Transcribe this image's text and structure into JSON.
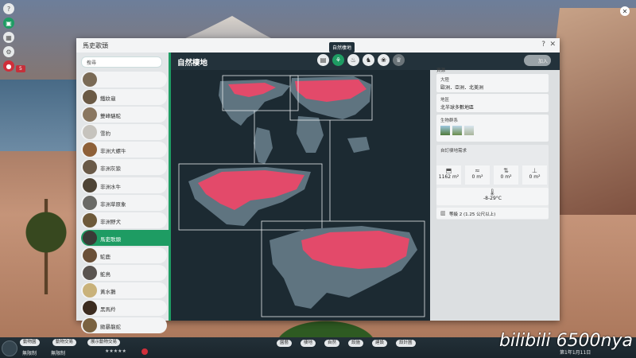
{
  "window": {
    "title": "馬吏歌頭",
    "help": "?",
    "close": "✕",
    "tooltip": "自然棲地"
  },
  "search": {
    "placeholder": "搜尋"
  },
  "animals": [
    {
      "name": "",
      "selected": false
    },
    {
      "name": "鐵紋龜",
      "selected": false
    },
    {
      "name": "雙峰駱駝",
      "selected": false
    },
    {
      "name": "雪豹",
      "selected": false
    },
    {
      "name": "非洲大螺牛",
      "selected": false
    },
    {
      "name": "非洲灰狼",
      "selected": false
    },
    {
      "name": "非洲水牛",
      "selected": false
    },
    {
      "name": "非洲草原象",
      "selected": false
    },
    {
      "name": "非洲野犬",
      "selected": false
    },
    {
      "name": "馬吏歌頭",
      "selected": true
    },
    {
      "name": "駝鹿",
      "selected": false
    },
    {
      "name": "鴕鳥",
      "selected": false
    },
    {
      "name": "黃水鵝",
      "selected": false
    },
    {
      "name": "黑馬羚",
      "selected": false
    },
    {
      "name": "颱暴龍蛇",
      "selected": false
    }
  ],
  "main": {
    "title": "自然棲地",
    "plus_label": "加入"
  },
  "tabs": [
    {
      "icon": "clipboard-icon",
      "glyph": "▤",
      "state": "normal"
    },
    {
      "icon": "habitat-tree-icon",
      "glyph": "⚘",
      "state": "selected"
    },
    {
      "icon": "food-sack-icon",
      "glyph": "♨",
      "state": "normal"
    },
    {
      "icon": "enrichment-icon",
      "glyph": "♞",
      "state": "normal"
    },
    {
      "icon": "paw-icon",
      "glyph": "❀",
      "state": "normal"
    },
    {
      "icon": "trophy-icon",
      "glyph": "♛",
      "state": "dim"
    }
  ],
  "info": {
    "section_label": "資源",
    "continent_label": "大陸",
    "continent_value": "歐洲．亞洲．北美洲",
    "region_label": "地區",
    "region_value": "北半球多數地區",
    "biome_label": "生物群系",
    "habitat_req_label": "自訂棲地需求",
    "stats": [
      {
        "icon": "land-area-icon",
        "glyph": "⬒",
        "value": "1162 m²"
      },
      {
        "icon": "water-area-icon",
        "glyph": "≈",
        "value": "0 m²"
      },
      {
        "icon": "climb-area-icon",
        "glyph": "⇅",
        "value": "0 m²"
      },
      {
        "icon": "deep-water-icon",
        "glyph": "⊥",
        "value": "0 m²"
      }
    ],
    "temperature": "-8-29°C",
    "fence": "等級 2 (1.25 公尺以上)"
  },
  "bottom": {
    "btn_left": [
      "動物園",
      "動物交易",
      "展示動物交易"
    ],
    "unlimited1": "無限制",
    "unlimited2": "無限制",
    "btn_center": [
      "園藝",
      "棲地",
      "自然",
      "設施",
      "建設",
      "設計圖"
    ],
    "date": "第1年1月11日"
  },
  "brand": "bilibili 6500nya",
  "colors": {
    "accent": "#1e9c63",
    "map_land": "#5f7480",
    "map_range": "#e34a6a",
    "map_bg": "#1c2a32"
  }
}
